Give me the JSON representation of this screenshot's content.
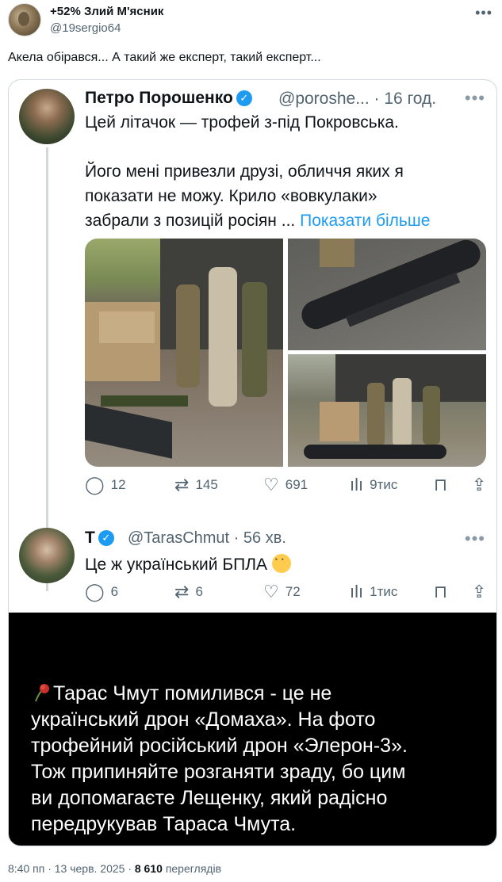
{
  "header": {
    "author_name": "+52% Злий М'ясник",
    "author_handle": "@19sergio64",
    "more_icon": "more-horizontal-icon"
  },
  "tweet": {
    "text": "Акела обі​рався... А такий же експерт, такий експерт..."
  },
  "quote": {
    "name": "Петро Порошенко",
    "handle": "@poroshe... · 16 год.",
    "line1": "Цей літачок — трофей з-під Покровська.",
    "line2": "Його мені привезли друзі, обличчя яких я",
    "line3": "показати не можу. Крило «вовкулаки»",
    "line4": "забрали з позицій росіян ...",
    "show_more": "Показати більше",
    "stats": {
      "replies": "12",
      "reposts": "145",
      "likes": "691",
      "views": "9тис"
    }
  },
  "reply": {
    "name": "T",
    "handle": "@TarasChmut · 56 хв.",
    "text": "Це ж український БПЛА",
    "stats": {
      "replies": "6",
      "reposts": "6",
      "likes": "72",
      "views": "1тис"
    }
  },
  "black_panel": {
    "line1": "Тарас Чмут помилився - це не",
    "line2": "український дрон «Домаха». На фото",
    "line3": "трофейний російський дрон «Элерон-3».",
    "line4": "Тож припиняйте розганяти зраду, бо цим",
    "line5": "ви допомагаєте Лещенку, який радісно",
    "line6": "передрукував Тараса Чмута."
  },
  "footer": {
    "time": "8:40 пп · 13 черв. 2025 · ",
    "views_count": "8 610",
    "views_label": "переглядів"
  },
  "colors": {
    "accent": "#1d9bf0",
    "secondary_text": "#536471",
    "border": "#cfd9de"
  }
}
